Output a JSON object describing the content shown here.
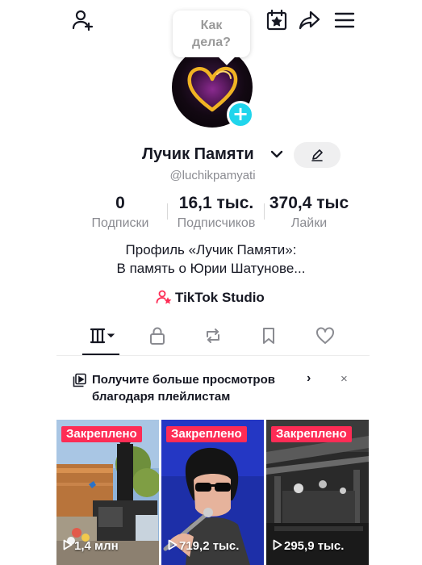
{
  "header": {
    "icons": [
      "add-friend-icon",
      "calendar-star-icon",
      "share-icon",
      "menu-icon"
    ]
  },
  "bubble": {
    "line1": "Как",
    "line2": "дела?"
  },
  "profile": {
    "name": "Лучик Памяти",
    "handle": "@luchikpamyati",
    "avatar_icon": "heart-icon",
    "add_icon": "+"
  },
  "stats": [
    {
      "value": "0",
      "label": "Подписки"
    },
    {
      "value": "16,1 тыс.",
      "label": "Подписчиков"
    },
    {
      "value": "370,4 тыс",
      "label": "Лайки"
    }
  ],
  "bio": {
    "line1": "Профиль «Лучик Памяти»:",
    "line2": "В память о Юрии Шатунове..."
  },
  "studio": {
    "label": "TikTok Studio"
  },
  "tabs": [
    "grid-icon",
    "lock-icon",
    "repost-icon",
    "bookmark-icon",
    "heart-icon"
  ],
  "promo": {
    "line1": "Получите больше просмотров",
    "line2": "благодаря плейлистам",
    "arrow": "›",
    "close": "×"
  },
  "videos": [
    {
      "badge": "Закреплено",
      "views": "1,4 млн"
    },
    {
      "badge": "Закреплено",
      "views": "719,2 тыс."
    },
    {
      "badge": "Закреплено",
      "views": "295,9 тыс."
    }
  ],
  "colors": {
    "accent": "#fe2c55",
    "plus": "#20d5ec",
    "heart": "#f0b323"
  }
}
